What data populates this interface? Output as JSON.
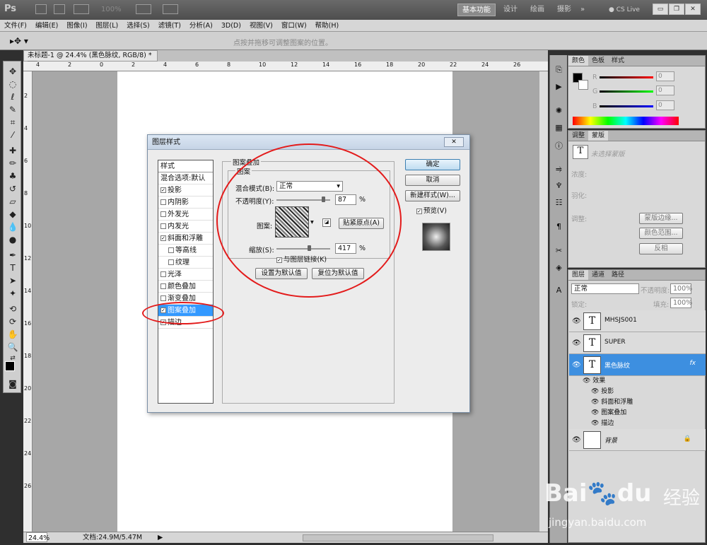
{
  "app": {
    "logo": "Ps",
    "zoom": "100%",
    "workspaces": [
      "基本功能",
      "设计",
      "绘画",
      "摄影"
    ],
    "active_workspace": "基本功能",
    "cslive": "CS Live"
  },
  "menu": [
    "文件(F)",
    "编辑(E)",
    "图像(I)",
    "图层(L)",
    "选择(S)",
    "滤镜(T)",
    "分析(A)",
    "3D(D)",
    "视图(V)",
    "窗口(W)",
    "帮助(H)"
  ],
  "options_hint": "点按并拖移可调整图案的位置。",
  "document": {
    "tab": "未标题-1 @ 24.4% (黑色脉纹, RGB/8) *",
    "zoom": "24.4%",
    "status": "文档:24.9M/5.47M",
    "ruler_h": [
      "4",
      "2",
      "0",
      "2",
      "4",
      "6",
      "8",
      "10",
      "12",
      "14",
      "16",
      "18",
      "20",
      "22",
      "24",
      "26"
    ],
    "ruler_v": [
      "2",
      "4",
      "6",
      "8",
      "10",
      "12",
      "14",
      "16",
      "18",
      "20",
      "22",
      "24",
      "26"
    ]
  },
  "dialog": {
    "title": "图层样式",
    "styles_header": "样式",
    "styles": [
      {
        "label": "混合选项:默认",
        "check": null,
        "sel": false
      },
      {
        "label": "投影",
        "check": true,
        "sel": false
      },
      {
        "label": "内阴影",
        "check": false,
        "sel": false
      },
      {
        "label": "外发光",
        "check": false,
        "sel": false
      },
      {
        "label": "内发光",
        "check": false,
        "sel": false
      },
      {
        "label": "斜面和浮雕",
        "check": true,
        "sel": false
      },
      {
        "label": "等高线",
        "check": false,
        "sel": false,
        "indent": true
      },
      {
        "label": "纹理",
        "check": false,
        "sel": false,
        "indent": true
      },
      {
        "label": "光泽",
        "check": false,
        "sel": false
      },
      {
        "label": "颜色叠加",
        "check": false,
        "sel": false
      },
      {
        "label": "渐变叠加",
        "check": false,
        "sel": false
      },
      {
        "label": "图案叠加",
        "check": true,
        "sel": true
      },
      {
        "label": "描边",
        "check": true,
        "sel": false
      }
    ],
    "section": "图案叠加",
    "subsection": "图案",
    "blend_label": "混合模式(B):",
    "blend_value": "正常",
    "opacity_label": "不透明度(Y):",
    "opacity_value": "87",
    "opacity_level": 0.87,
    "percent": "%",
    "pattern_label": "图案:",
    "snap_button": "贴紧原点(A)",
    "scale_label": "缩放(S):",
    "scale_value": "417",
    "scale_level": 0.6,
    "link_label": "与图层链接(K)",
    "default_set": "设置为默认值",
    "default_reset": "复位为默认值",
    "ok": "确定",
    "cancel": "取消",
    "new_style": "新建样式(W)...",
    "preview": "预览(V)"
  },
  "color_panel": {
    "tabs": [
      "颜色",
      "色板",
      "样式"
    ],
    "channels": [
      {
        "name": "R",
        "value": "0"
      },
      {
        "name": "G",
        "value": "0"
      },
      {
        "name": "B",
        "value": "0"
      }
    ]
  },
  "adjust_panel": {
    "tabs": [
      "调整",
      "蒙版"
    ],
    "no_mask": "未选择蒙版",
    "density": "浓度:",
    "feather": "羽化:",
    "adjust": "调整:",
    "edge": "蒙版边缘...",
    "range": "颜色范围...",
    "invert": "反相"
  },
  "layers_panel": {
    "tabs": [
      "图层",
      "通道",
      "路径"
    ],
    "blend": "正常",
    "opacity_label": "不透明度:",
    "opacity": "100%",
    "lock_label": "锁定:",
    "fill_label": "填充:",
    "fill": "100%",
    "layers": [
      {
        "name": "MHSJS001",
        "type": "T"
      },
      {
        "name": "SUPER",
        "type": "T"
      },
      {
        "name": "黑色脉纹",
        "type": "T",
        "fx": "fx",
        "selected": true
      },
      {
        "name": "背景",
        "type": ""
      }
    ],
    "effects_label": "效果",
    "effects": [
      "投影",
      "斜面和浮雕",
      "图案叠加",
      "描边"
    ]
  },
  "watermark": {
    "brand": "Bai",
    "brand2": "du",
    "cn": "经验",
    "url": "jingyan.baidu.com"
  }
}
